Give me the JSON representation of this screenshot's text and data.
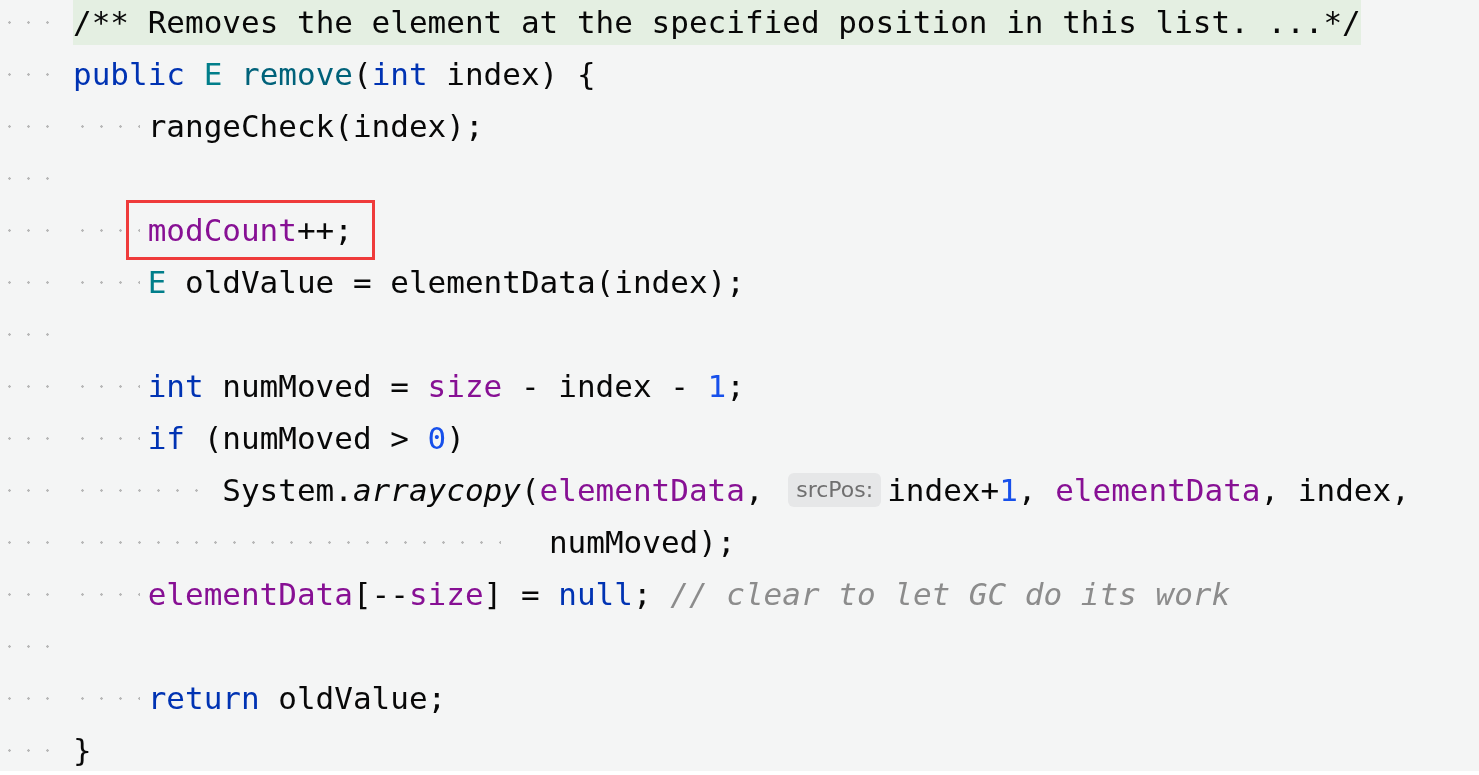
{
  "editor": {
    "lines": [
      {
        "kind": "doc",
        "tokens": [
          {
            "kind": "doc",
            "text": "/** Removes the element at the specified position in this list. ...*/"
          }
        ]
      },
      {
        "kind": "code",
        "tokens": [
          {
            "kind": "keyword",
            "text": "public "
          },
          {
            "kind": "type",
            "text": "E "
          },
          {
            "kind": "method",
            "text": "remove"
          },
          {
            "kind": "plain",
            "text": "("
          },
          {
            "kind": "keyword",
            "text": "int "
          },
          {
            "kind": "plain",
            "text": "index) {"
          }
        ],
        "children": [
          {
            "kind": "code",
            "tokens": [
              {
                "kind": "plain",
                "text": "rangeCheck(index);"
              }
            ]
          },
          {
            "kind": "blank"
          },
          {
            "kind": "code",
            "highlighted": true,
            "tokens": [
              {
                "kind": "field",
                "text": "modCount"
              },
              {
                "kind": "plain",
                "text": "++;"
              }
            ]
          },
          {
            "kind": "code",
            "tokens": [
              {
                "kind": "type",
                "text": "E "
              },
              {
                "kind": "plain",
                "text": "oldValue = elementData(index);"
              }
            ]
          },
          {
            "kind": "blank"
          },
          {
            "kind": "code",
            "tokens": [
              {
                "kind": "keyword",
                "text": "int "
              },
              {
                "kind": "plain",
                "text": "numMoved = "
              },
              {
                "kind": "field",
                "text": "size"
              },
              {
                "kind": "plain",
                "text": " - index - "
              },
              {
                "kind": "number",
                "text": "1"
              },
              {
                "kind": "plain",
                "text": ";"
              }
            ]
          },
          {
            "kind": "code",
            "tokens": [
              {
                "kind": "keyword",
                "text": "if "
              },
              {
                "kind": "plain",
                "text": "(numMoved > "
              },
              {
                "kind": "number",
                "text": "0"
              },
              {
                "kind": "plain",
                "text": ")"
              }
            ],
            "children": [
              {
                "kind": "code",
                "tokens": [
                  {
                    "kind": "plain",
                    "text": "System."
                  },
                  {
                    "kind": "static",
                    "text": "arraycopy"
                  },
                  {
                    "kind": "plain",
                    "text": "("
                  },
                  {
                    "kind": "field",
                    "text": "elementData"
                  },
                  {
                    "kind": "plain",
                    "text": ", "
                  },
                  {
                    "kind": "hint",
                    "text": "srcPos:"
                  },
                  {
                    "kind": "plain",
                    "text": "index+"
                  },
                  {
                    "kind": "number",
                    "text": "1"
                  },
                  {
                    "kind": "plain",
                    "text": ", "
                  },
                  {
                    "kind": "field",
                    "text": "elementData"
                  },
                  {
                    "kind": "plain",
                    "text": ", index,"
                  }
                ],
                "children": [
                  {
                    "kind": "continuation",
                    "tokens": [
                      {
                        "kind": "plain",
                        "text": "numMoved);"
                      }
                    ]
                  }
                ]
              }
            ]
          },
          {
            "kind": "code",
            "tokens": [
              {
                "kind": "field",
                "text": "elementData"
              },
              {
                "kind": "plain",
                "text": "[--"
              },
              {
                "kind": "field",
                "text": "size"
              },
              {
                "kind": "plain",
                "text": "] = "
              },
              {
                "kind": "keyword",
                "text": "null"
              },
              {
                "kind": "plain",
                "text": "; "
              },
              {
                "kind": "comment",
                "text": "// clear to let GC do its work"
              }
            ]
          },
          {
            "kind": "blank"
          },
          {
            "kind": "code",
            "tokens": [
              {
                "kind": "keyword",
                "text": "return "
              },
              {
                "kind": "plain",
                "text": "oldValue;"
              }
            ]
          }
        ]
      },
      {
        "kind": "code",
        "tokens": [
          {
            "kind": "plain",
            "text": "}"
          }
        ]
      }
    ]
  }
}
